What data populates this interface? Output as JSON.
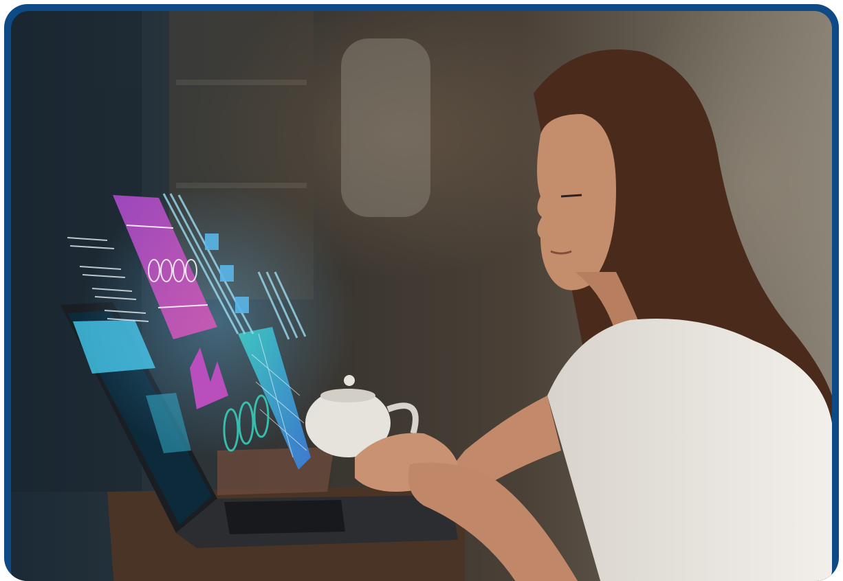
{
  "scene": {
    "subject": "woman",
    "device": "laptop",
    "holograms": [
      "pink-chart-panel",
      "cyan-table-panel",
      "dial-icons",
      "code-lines"
    ]
  },
  "colors": {
    "border": "#0e4a86",
    "hologram_pink": "#c04fc8",
    "hologram_cyan": "#47c8e8",
    "shirt": "#e9e5df",
    "hair": "#5a3220"
  }
}
